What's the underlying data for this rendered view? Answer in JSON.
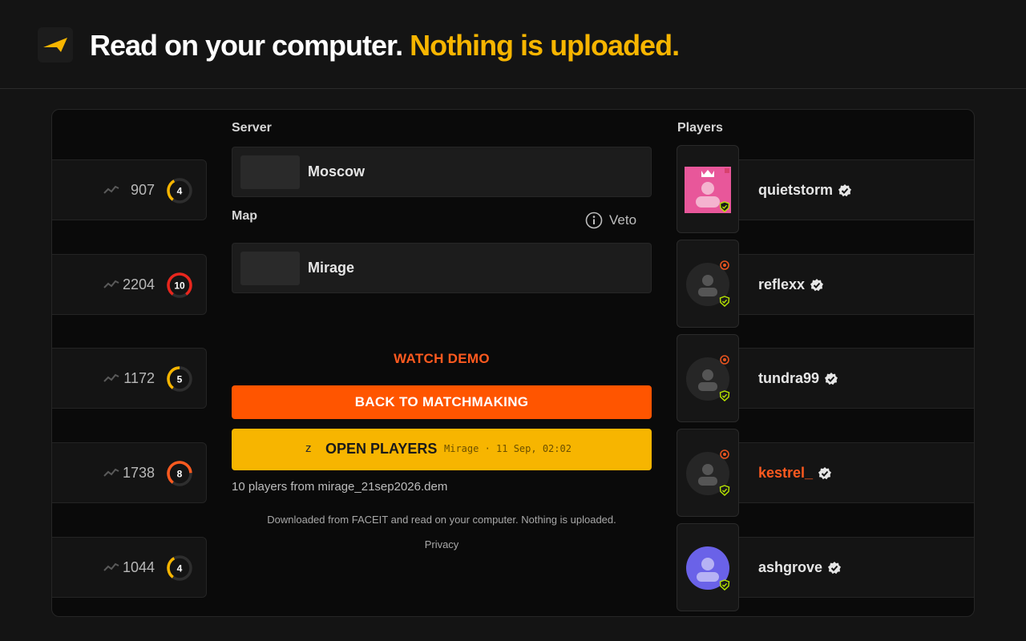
{
  "header": {
    "title_white": "Read on your computer.",
    "title_yellow": "Nothing is uploaded."
  },
  "left_rows": [
    {
      "elo": "907",
      "level": "4",
      "level_fraction": 0.4,
      "color": "#f7b500"
    },
    {
      "elo": "2204",
      "level": "10",
      "level_fraction": 1.0,
      "color": "#e8261d"
    },
    {
      "elo": "1172",
      "level": "5",
      "level_fraction": 0.5,
      "color": "#f7b500"
    },
    {
      "elo": "1738",
      "level": "8",
      "level_fraction": 0.8,
      "color": "#ff5a1f"
    },
    {
      "elo": "1044",
      "level": "4",
      "level_fraction": 0.4,
      "color": "#f7b500"
    }
  ],
  "server": {
    "label": "Server",
    "value": "Moscow"
  },
  "map": {
    "label": "Map",
    "value": "Mirage",
    "veto_label": "Veto"
  },
  "actions": {
    "watch_demo": "WATCH DEMO",
    "back": "BACK TO MATCHMAKING",
    "open_key": "z",
    "open": "OPEN PLAYERS",
    "open_meta": "Mirage · 11 Sep, 02:02"
  },
  "file_info": "10 players from mirage_21sep2026.dem",
  "disclaimer": "Downloaded from FACEIT and read on your computer. Nothing is uploaded. Privacy",
  "players_label": "Players",
  "players": [
    {
      "name": "quietstorm",
      "avatar": "crown-avatar",
      "highlight": false
    },
    {
      "name": "reflexx",
      "avatar": "default-avatar",
      "highlight": false
    },
    {
      "name": "tundra99",
      "avatar": "default-avatar",
      "highlight": false
    },
    {
      "name": "kestrel_",
      "avatar": "default-avatar",
      "highlight": true
    },
    {
      "name": "ashgrove",
      "avatar": "purple-avatar",
      "highlight": false
    }
  ],
  "colors": {
    "accent_orange": "#ff5500",
    "accent_yellow": "#f7b500",
    "verified": "#e6e6e6",
    "shield": "#b8e600"
  }
}
